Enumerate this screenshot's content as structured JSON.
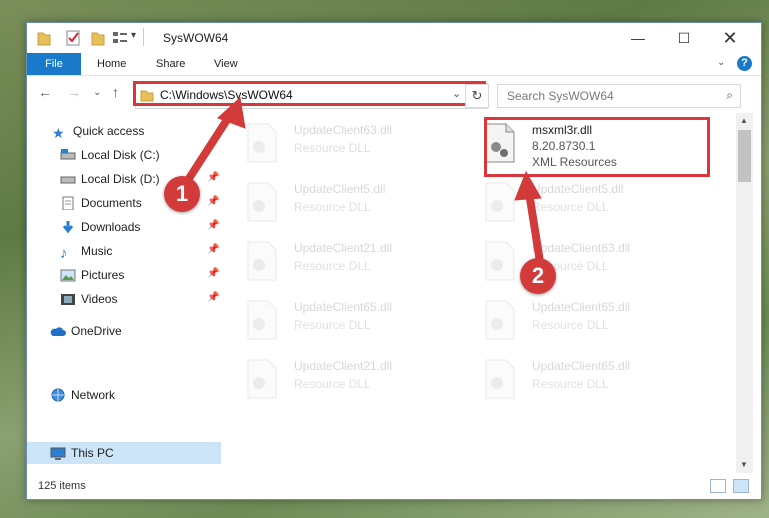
{
  "window": {
    "title": "SysWOW64"
  },
  "ribbon": {
    "file": "File",
    "home": "Home",
    "share": "Share",
    "view": "View",
    "help": "?"
  },
  "address": {
    "path": "C:\\Windows\\SysWOW64"
  },
  "search": {
    "placeholder": "Search SysWOW64"
  },
  "sidebar": {
    "items": [
      {
        "label": "Quick access",
        "icon": "star-icon",
        "pinned": false
      },
      {
        "label": "Local Disk (C:)",
        "icon": "drive-icon",
        "pinned": false
      },
      {
        "label": "Local Disk (D:)",
        "icon": "drive-icon",
        "pinned": true
      },
      {
        "label": "Documents",
        "icon": "documents-icon",
        "pinned": true
      },
      {
        "label": "Downloads",
        "icon": "download-icon",
        "pinned": true
      },
      {
        "label": "Music",
        "icon": "music-icon",
        "pinned": true
      },
      {
        "label": "Pictures",
        "icon": "pictures-icon",
        "pinned": true
      },
      {
        "label": "Videos",
        "icon": "videos-icon",
        "pinned": true
      },
      {
        "label": "OneDrive",
        "icon": "cloud-icon",
        "pinned": false
      },
      {
        "label": "This PC",
        "icon": "computer-icon",
        "pinned": false,
        "selected": true
      },
      {
        "label": "Network",
        "icon": "network-icon",
        "pinned": false
      }
    ]
  },
  "files": {
    "left": [
      {
        "name": "UpdateClient63.dll",
        "desc": "Resource DLL"
      },
      {
        "name": "UpdateClient5.dll",
        "desc": "Resource DLL"
      },
      {
        "name": "UpdateClient21.dll",
        "desc": "Resource DLL"
      },
      {
        "name": "UpdateClient65.dll",
        "desc": "Resource DLL"
      },
      {
        "name": "UpdateClient21.dll",
        "desc": "Resource DLL"
      }
    ],
    "right": [
      {
        "name": "msxml3r.dll",
        "version": "8.20.8730.1",
        "desc": "XML Resources"
      },
      {
        "name": "UpdateClient5.dll",
        "desc": "Resource DLL"
      },
      {
        "name": "UpdateClient63.dll",
        "desc": "Resource DLL"
      },
      {
        "name": "UpdateClient65.dll",
        "desc": "Resource DLL"
      },
      {
        "name": "UpdateClient65.dll",
        "desc": "Resource DLL"
      }
    ]
  },
  "status": {
    "count": "125 items"
  },
  "markers": {
    "one": "1",
    "two": "2"
  },
  "colors": {
    "accent": "#1979ca",
    "highlight": "#d9373c",
    "selection": "#cce4f7"
  }
}
